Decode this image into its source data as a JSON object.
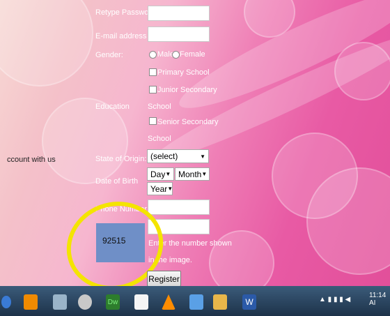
{
  "form": {
    "retype_password_label": "Retype Password:",
    "email_label": "E-mail address",
    "gender_label": "Gender:",
    "gender_male": "Male",
    "gender_female": "Female",
    "education_label": "Education",
    "edu_primary": "Primary School",
    "edu_junior_line1": "Junior Secondary",
    "edu_junior_line2": "School",
    "edu_senior_line1": "Senior Secondary",
    "edu_senior_line2": "School",
    "state_label": "State of Origin:",
    "state_value": "(select)",
    "dob_label": "Date of Birth",
    "dob_day": "Day",
    "dob_month": "Month",
    "dob_year": "Year",
    "phone_label": "Phone Number",
    "captcha_number": "92515",
    "captcha_hint_line1": "Enter the number shown",
    "captcha_hint_line2": "in the image.",
    "register_label": "Register",
    "left_partial_text": "ccount with us"
  },
  "taskbar": {
    "clock": "11:14 AI"
  },
  "colors": {
    "highlight_ring": "#f4e400",
    "captcha_bg": "#6f8fc7",
    "taskbar": "#1d3249"
  }
}
